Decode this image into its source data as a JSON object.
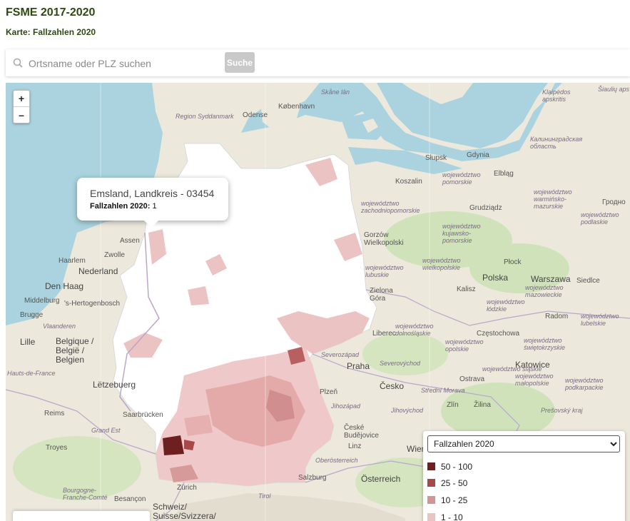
{
  "header": {
    "title": "FSME 2017-2020",
    "subtitle": "Karte: Fallzahlen 2020"
  },
  "search": {
    "placeholder": "Ortsname oder PLZ suchen",
    "button_label": "Suche"
  },
  "map": {
    "zoom_in": "+",
    "zoom_out": "–",
    "popup": {
      "name": "Emsland, Landkreis - 03454",
      "metric_label": "Fallzahlen 2020:",
      "metric_value": "1"
    },
    "labels": {
      "kobenhavn": "København",
      "odense": "Odense",
      "region_syddanmark": "Region Syddanmark",
      "skane": "Skåne län",
      "klaipedos": "Klaipėdos apskritis",
      "siauliu": "Šiaulių aps",
      "slupsk": "Słupsk",
      "gdynia": "Gdynia",
      "elblag": "Elbląg",
      "kaliningrad": "Калининградская область",
      "koszalin": "Koszalin",
      "pomorskie": "województwo pomorskie",
      "zachodniopomorskie": "województwo zachodniopomorskie",
      "grudziadz": "Grudziądz",
      "warminsko": "województwo warmińsko-mazurskie",
      "grodno": "Гродно",
      "podlaskie": "województwo podlaskie",
      "kujawsko": "województwo kujawsko-pomorskie",
      "assen": "Assen",
      "zwolle": "Zwolle",
      "haarlem": "Haarlem",
      "nederland": "Nederland",
      "denhaag": "Den Haag",
      "middelburg": "Middelburg",
      "hertogenbosch": "'s-Hertogenbosch",
      "brugge": "Brugge",
      "vlaanderen": "Vlaanderen",
      "lille": "Lille",
      "belgique": "Belgique / België / Belgien",
      "hautsdefrance": "Hauts-de-France",
      "letzebuerg": "Lëtzebuerg",
      "reims": "Reims",
      "saarbrucken": "Saarbrücken",
      "grandest": "Grand Est",
      "troyes": "Troyes",
      "bourgogne": "Bourgogne-Franche-Comté",
      "besancon": "Besançon",
      "zurich": "Zürich",
      "schweiz": "Schweiz/ Suisse/Svizzera/",
      "gorzow": "Gorzów Wielkopolski",
      "lubuskie": "województwo lubuskie",
      "wielkopolskie": "województwo wielkopolskie",
      "polska": "Polska",
      "plock": "Płock",
      "warszawa": "Warszawa",
      "siedlce": "Siedlce",
      "mazowieckie": "województwo mazowieckie",
      "kalisz": "Kalisz",
      "lodzkie": "województwo łódzkie",
      "radom": "Radom",
      "lubelskie": "województwo lubelskie",
      "zielona": "Zielona Góra",
      "dolnoslaskie": "województwo dolnośląskie",
      "opolskie": "województwo opolskie",
      "czestochowa": "Częstochowa",
      "swietokrzyskie": "województwo świętokrzyskie",
      "katowice": "Katowice",
      "slaskie": "województwo śląskie",
      "malopolskie": "województwo małopolskie",
      "podkarpackie": "województwo podkarpackie",
      "severozapad": "Severozápad",
      "praha": "Praha",
      "severovychod": "Severovýchod",
      "cesko": "Česko",
      "plzen": "Plzeň",
      "strednimorava": "Střední Morava",
      "ostrava": "Ostrava",
      "jihozapad": "Jihozápad",
      "jihovychod": "Jihovýchod",
      "zlin": "Zlín",
      "zilina": "Žilina",
      "presovsky": "Prešovský kraj",
      "ceske": "České Budějovice",
      "linz": "Linz",
      "wien": "Wien",
      "oberosterreich": "Oberösterreich",
      "osterreich": "Österreich",
      "salzburg": "Salzburg",
      "tirol": "Tirol",
      "liberec": "Liberec"
    }
  },
  "legend": {
    "selected": "Fallzahlen 2020",
    "items": [
      {
        "label": "50 - 100",
        "color": "#6e1f1f"
      },
      {
        "label": "25 - 50",
        "color": "#a84848"
      },
      {
        "label": "10 - 25",
        "color": "#d49494"
      },
      {
        "label": "1 - 10",
        "color": "#eac3c3"
      }
    ]
  },
  "colors": {
    "title": "#2e4a10",
    "water": "#aad3df",
    "land": "#eae6da",
    "forest": "#c8dfb0",
    "germany_fill": "#ffffff"
  }
}
